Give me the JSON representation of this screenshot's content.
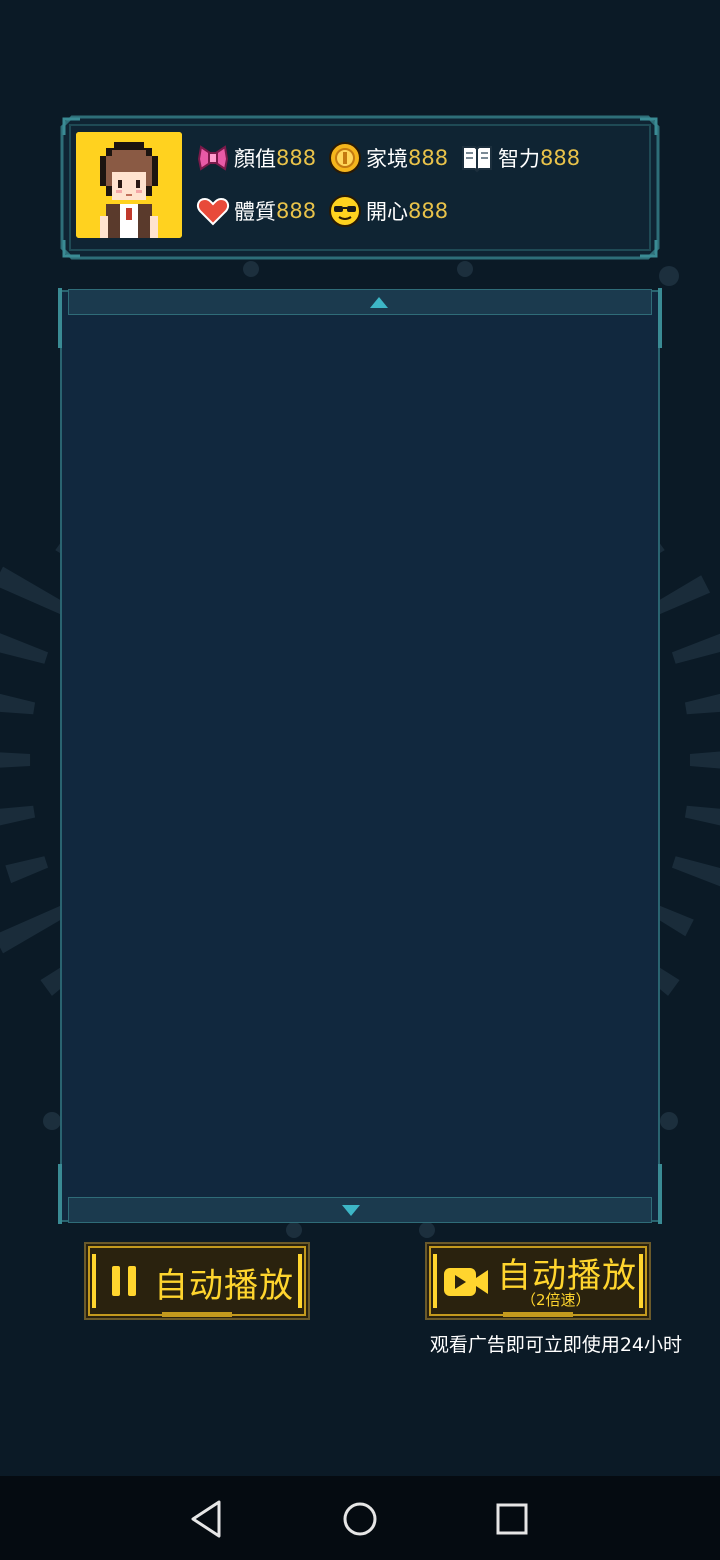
{
  "stats": [
    {
      "label": "顏值",
      "value": "888",
      "icon": "bow-icon"
    },
    {
      "label": "家境",
      "value": "888",
      "icon": "coin-icon"
    },
    {
      "label": "智力",
      "value": "888",
      "icon": "book-icon"
    },
    {
      "label": "體質",
      "value": "888",
      "icon": "heart-icon"
    },
    {
      "label": "開心",
      "value": "888",
      "icon": "sunglasses-face-icon"
    }
  ],
  "controls": {
    "autoplay_label": "自动播放",
    "autoplay_icon": "pause-icon",
    "autoplay2x_label": "自动播放",
    "autoplay2x_sub": "（2倍速）",
    "autoplay2x_icon": "video-camera-icon",
    "ad_note": "观看广告即可立即使用24小时"
  },
  "scroll_icons": {
    "up": "triangle-up-icon",
    "down": "triangle-down-icon"
  },
  "navbar": {
    "back": "back-triangle-icon",
    "home": "home-circle-icon",
    "recents": "recents-square-icon"
  },
  "colors": {
    "background": "#0b1a26",
    "panel": "#11283e",
    "frame": "#2e6e78",
    "accent_cyan": "#3db6c6",
    "gold": "#ffd52e",
    "stat_value": "#e8c24a"
  }
}
